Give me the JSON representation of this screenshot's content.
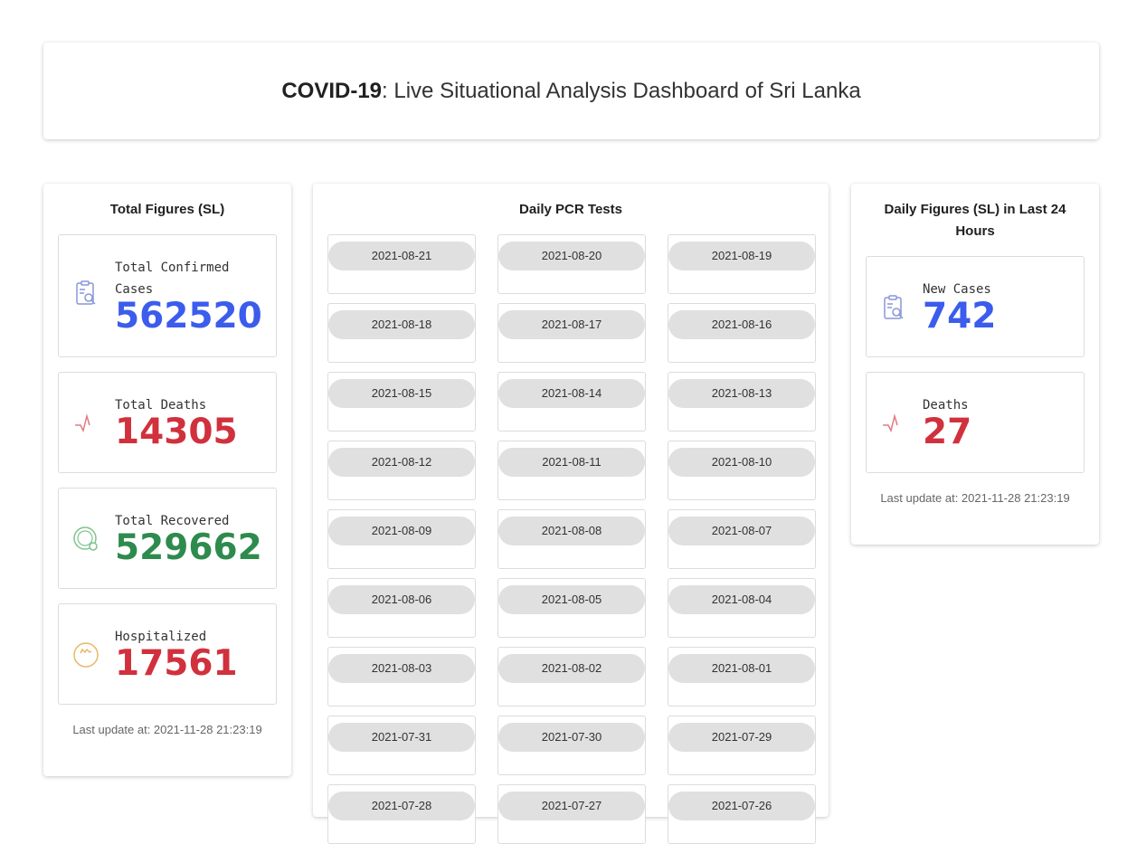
{
  "header": {
    "title_bold": "COVID-19",
    "title_rest": ": Live Situational Analysis Dashboard of Sri Lanka"
  },
  "total": {
    "title": "Total Figures (SL)",
    "stats": [
      {
        "label": "Total Confirmed Cases",
        "value": "562520",
        "icon": "clipboard-search-icon"
      },
      {
        "label": "Total Deaths",
        "value": "14305",
        "icon": "heartbeat-icon"
      },
      {
        "label": "Total Recovered",
        "value": "529662",
        "icon": "recovery-circle-icon"
      },
      {
        "label": "Hospitalized",
        "value": "17561",
        "icon": "hospital-bed-icon"
      }
    ],
    "last_update": "Last update at: 2021-11-28 21:23:19"
  },
  "pcr": {
    "title": "Daily PCR Tests",
    "dates": [
      "2021-08-21",
      "2021-08-20",
      "2021-08-19",
      "2021-08-18",
      "2021-08-17",
      "2021-08-16",
      "2021-08-15",
      "2021-08-14",
      "2021-08-13",
      "2021-08-12",
      "2021-08-11",
      "2021-08-10",
      "2021-08-09",
      "2021-08-08",
      "2021-08-07",
      "2021-08-06",
      "2021-08-05",
      "2021-08-04",
      "2021-08-03",
      "2021-08-02",
      "2021-08-01",
      "2021-07-31",
      "2021-07-30",
      "2021-07-29",
      "2021-07-28",
      "2021-07-27",
      "2021-07-26"
    ]
  },
  "daily": {
    "title": "Daily Figures (SL) in Last 24 Hours",
    "stats": [
      {
        "label": "New Cases",
        "value": "742",
        "icon": "clipboard-search-icon"
      },
      {
        "label": "Deaths",
        "value": "27",
        "icon": "heartbeat-icon"
      }
    ],
    "last_update": "Last update at: 2021-11-28 21:23:19"
  },
  "colors": {
    "cases": "#3b5cec",
    "deaths": "#d0313d",
    "recovered": "#2e8b4e",
    "hospitalized": "#d0313d"
  }
}
